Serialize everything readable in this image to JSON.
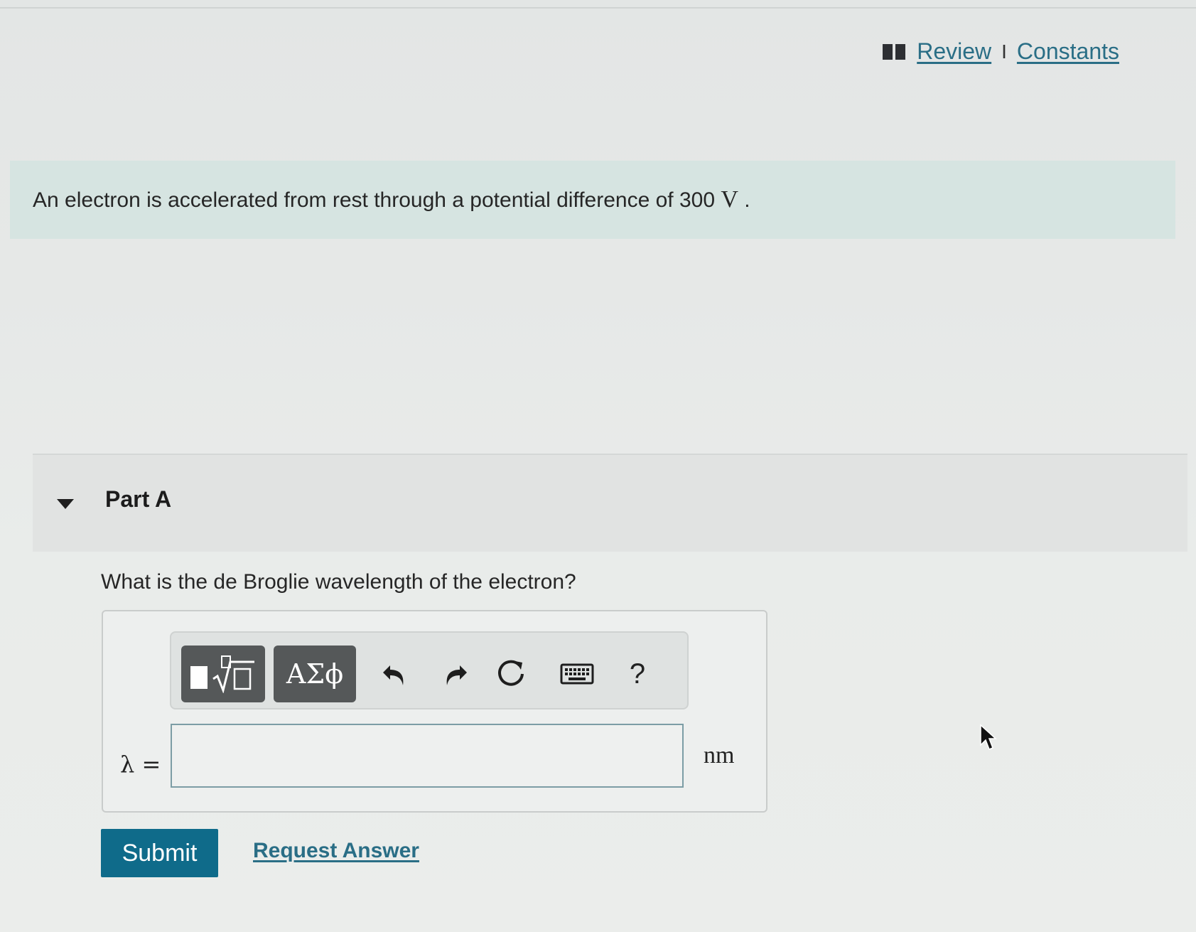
{
  "top_links": {
    "review": "Review",
    "separator": "I",
    "constants": "Constants"
  },
  "intro": {
    "text": "An electron is accelerated from rest through a potential difference of 300",
    "unit": "V",
    "end": "."
  },
  "part": {
    "title": "Part A",
    "question": "What is the de Broglie wavelength of the electron?"
  },
  "toolbar": {
    "templates_icon": "template-sqrt-icon",
    "greek_label": "ΑΣϕ",
    "help_label": "?",
    "icons": [
      "undo-icon",
      "redo-icon",
      "reset-icon",
      "keyboard-icon"
    ]
  },
  "answer": {
    "variable": "λ =",
    "value": "",
    "unit": "nm"
  },
  "actions": {
    "submit": "Submit",
    "request_answer": "Request Answer"
  },
  "colors": {
    "accent": "#0f6b8a",
    "link": "#2a6e86",
    "intro_bg": "#d6e4e1"
  }
}
